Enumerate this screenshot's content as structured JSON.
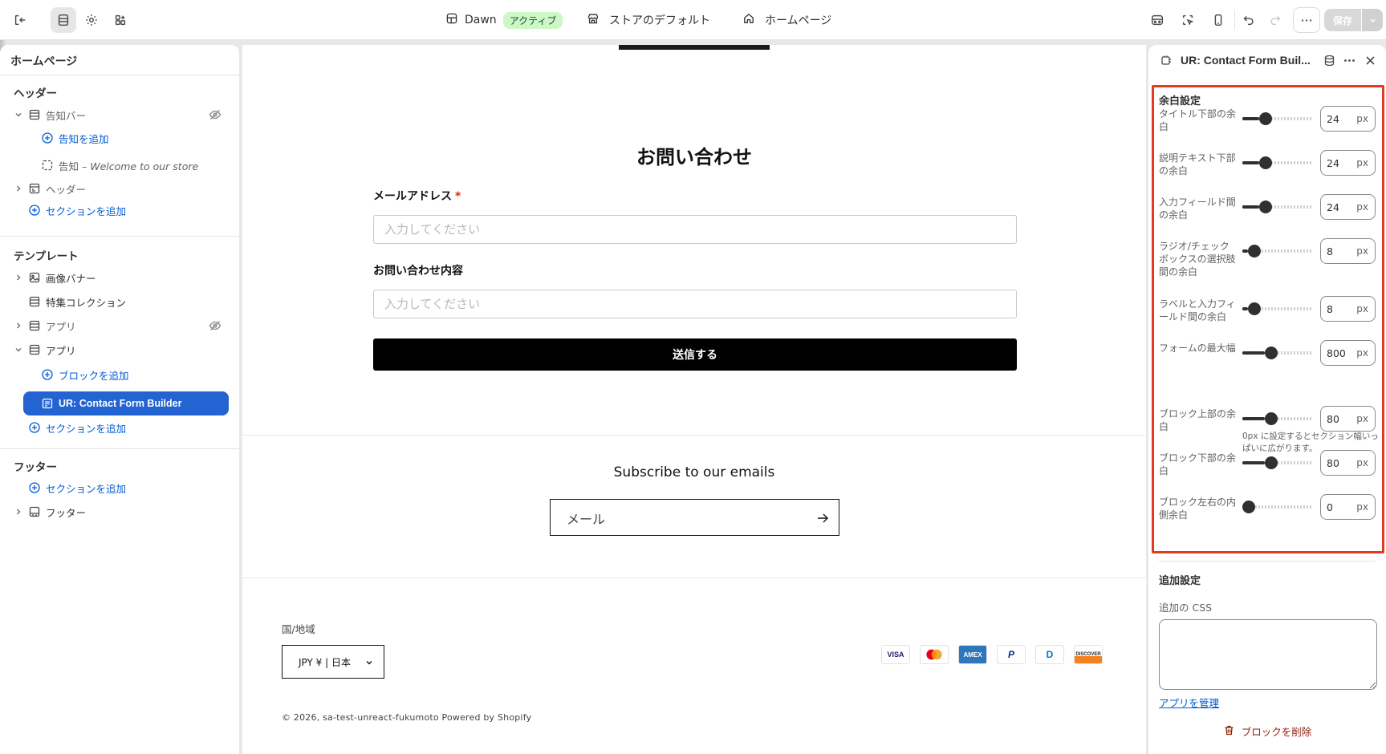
{
  "topbar": {
    "theme_name": "Dawn",
    "theme_status": "アクティブ",
    "store_default": "ストアのデフォルト",
    "page_name": "ホームページ",
    "more_label": "···",
    "save_label": "保存"
  },
  "sidebar": {
    "title": "ホームページ",
    "header_heading": "ヘッダー",
    "template_heading": "テンプレート",
    "footer_heading": "フッター",
    "items": {
      "announcement_bar": "告知バー",
      "add_announcement": "告知を追加",
      "announcement_prefix": "告知 – ",
      "announcement_text": "Welcome to our store",
      "header": "ヘッダー",
      "add_section_header": "セクションを追加",
      "image_banner": "画像バナー",
      "featured_collection": "特集コレクション",
      "app1": "アプリ",
      "app2": "アプリ",
      "add_block": "ブロックを追加",
      "selected_block": "UR: Contact Form Builder",
      "add_section_template": "セクションを追加",
      "add_section_footer": "セクションを追加",
      "footer": "フッター"
    }
  },
  "preview": {
    "form_title": "お問い合わせ",
    "email_label": "メールアドレス",
    "required_mark": "*",
    "email_placeholder": "入力してください",
    "inquiry_label": "お問い合わせ内容",
    "inquiry_placeholder": "入力してください",
    "submit_label": "送信する",
    "subscribe_title": "Subscribe to our emails",
    "subscribe_placeholder": "メール",
    "country_label": "国/地域",
    "country_value": "JPY ¥ | 日本",
    "payments": [
      "VISA",
      "MC",
      "AMEX",
      "P",
      "D",
      "DISCOVER"
    ],
    "copyright": "© 2026, sa-test-unreact-fukumoto Powered by Shopify"
  },
  "panel": {
    "title": "UR: Contact Form Buil...",
    "spacing_heading": "余白設定",
    "unit": "px",
    "rows": [
      {
        "label": "タイトル下部の余白",
        "value": "24",
        "fraction": 0.24
      },
      {
        "label": "説明テキスト下部の余白",
        "value": "24",
        "fraction": 0.24
      },
      {
        "label": "入力フィールド間の余白",
        "value": "24",
        "fraction": 0.24
      },
      {
        "label": "ラジオ/チェックボックスの選択肢間の余白",
        "value": "8",
        "fraction": 0.08
      },
      {
        "label": "ラベルと入力フィールド間の余白",
        "value": "8",
        "fraction": 0.08
      },
      {
        "label": "フォームの最大幅",
        "value": "800",
        "fraction": 0.32
      },
      {
        "label": "ブロック上部の余白",
        "value": "80",
        "fraction": 0.32
      },
      {
        "label": "ブロック下部の余白",
        "value": "80",
        "fraction": 0.32
      },
      {
        "label": "ブロック左右の内側余白",
        "value": "0",
        "fraction": 0
      }
    ],
    "max_width_help": "0px に設定するとセクション幅いっぱいに広がります。",
    "additional_heading": "追加設定",
    "css_label": "追加の CSS",
    "manage_app": "アプリを管理",
    "delete_block": "ブロックを削除"
  }
}
